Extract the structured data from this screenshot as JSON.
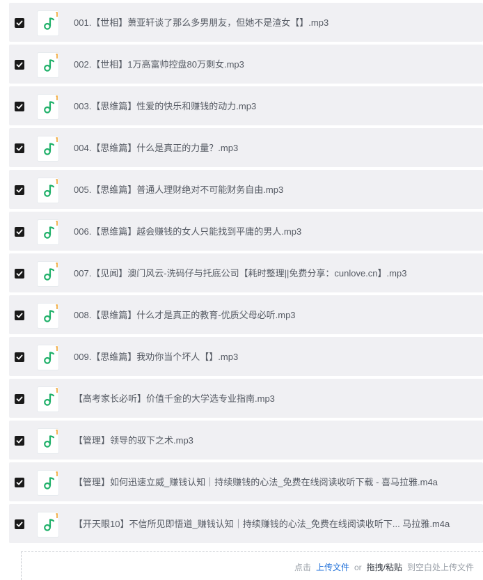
{
  "files": [
    {
      "name": "001.【世相】萧亚轩谈了那么多男朋友，但她不是渣女【】.mp3",
      "checked": true,
      "icon": "music-note-icon"
    },
    {
      "name": "002.【世相】1万高富帅控盘80万剩女.mp3",
      "checked": true,
      "icon": "music-note-icon"
    },
    {
      "name": "003.【思维篇】性爱的快乐和赚钱的动力.mp3",
      "checked": true,
      "icon": "music-note-icon"
    },
    {
      "name": "004.【思维篇】什么是真正的力量？.mp3",
      "checked": true,
      "icon": "music-note-icon"
    },
    {
      "name": "005.【思维篇】普通人理财绝对不可能财务自由.mp3",
      "checked": true,
      "icon": "music-note-icon"
    },
    {
      "name": "006.【思维篇】越会赚钱的女人只能找到平庸的男人.mp3",
      "checked": true,
      "icon": "music-note-icon"
    },
    {
      "name": "007.【见闻】澳门风云-洗码仔与托底公司【耗时整理||免费分享：cunlove.cn】.mp3",
      "checked": true,
      "icon": "music-note-icon"
    },
    {
      "name": "008.【思维篇】什么才是真正的教育-优质父母必听.mp3",
      "checked": true,
      "icon": "music-note-icon"
    },
    {
      "name": "009.【思维篇】我劝你当个坏人【】.mp3",
      "checked": true,
      "icon": "music-note-icon"
    },
    {
      "name": "【高考家长必听】价值千金的大学选专业指南.mp3",
      "checked": true,
      "icon": "music-note-icon"
    },
    {
      "name": "【管理】领导的驭下之术.mp3",
      "checked": true,
      "icon": "music-note-icon"
    },
    {
      "name": "【管理】如何迅速立威_赚钱认知｜持续赚钱的心法_免费在线阅读收听下载 - 喜马拉雅.m4a",
      "checked": true,
      "icon": "music-note-icon"
    },
    {
      "name": "【开天眼10】不信所见即悟道_赚钱认知｜持续赚钱的心法_免费在线阅读收听下... 马拉雅.m4a",
      "checked": true,
      "icon": "music-note-icon"
    }
  ],
  "dropzone": {
    "prefix": "点击",
    "upload_link": "上传文件",
    "or": "or",
    "paste": "拖拽/粘贴",
    "suffix": "到空白处上传文件"
  },
  "colors": {
    "row_bg": "#f0f0f3",
    "checkbox": "#1a1a1a",
    "icon_green": "#1fb069",
    "icon_accent": "#f0a12a",
    "link": "#1e6fd9"
  }
}
